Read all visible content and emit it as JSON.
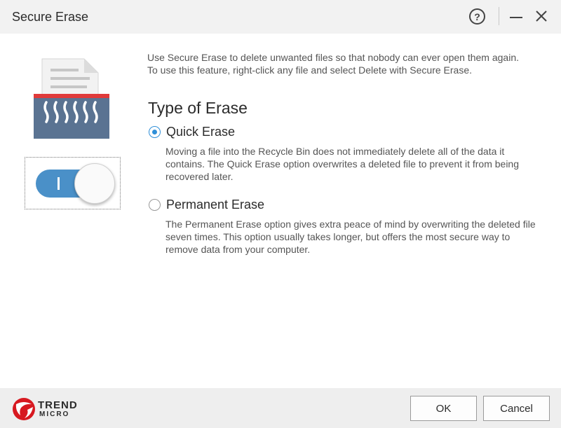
{
  "window": {
    "title": "Secure Erase"
  },
  "titlebar": {
    "help_icon": "question-circle-icon",
    "help_label": "?",
    "minimize_icon": "minimize-icon",
    "close_icon": "close-icon"
  },
  "toggle": {
    "state": "on",
    "on_glyph": "I"
  },
  "intro": {
    "line1": "Use Secure Erase to delete unwanted files so that nobody can ever open them again.",
    "line2": "To use this feature, right-click any file and select Delete with Secure Erase."
  },
  "erase": {
    "heading": "Type of Erase",
    "selected": "Quick Erase",
    "options": [
      {
        "label": "Quick Erase",
        "description": "Moving a file into the Recycle Bin does not immediately delete all of the data it contains. The Quick Erase option overwrites a deleted file to prevent it from being recovered later."
      },
      {
        "label": "Permanent Erase",
        "description": "The Permanent Erase option gives extra peace of mind by overwriting the deleted file seven times. This option usually takes longer, but offers the most secure way to remove data from your computer."
      }
    ]
  },
  "footer": {
    "brand_line1": "TREND",
    "brand_line2": "MICRO",
    "ok_label": "OK",
    "cancel_label": "Cancel"
  },
  "colors": {
    "accent": "#2f8fd8",
    "toggle_on": "#4a90c8",
    "brand_red": "#d71920",
    "shredder_red": "#e03a3a",
    "titlebar_bg": "#f2f2f2",
    "footer_bg": "#eeeeee"
  }
}
